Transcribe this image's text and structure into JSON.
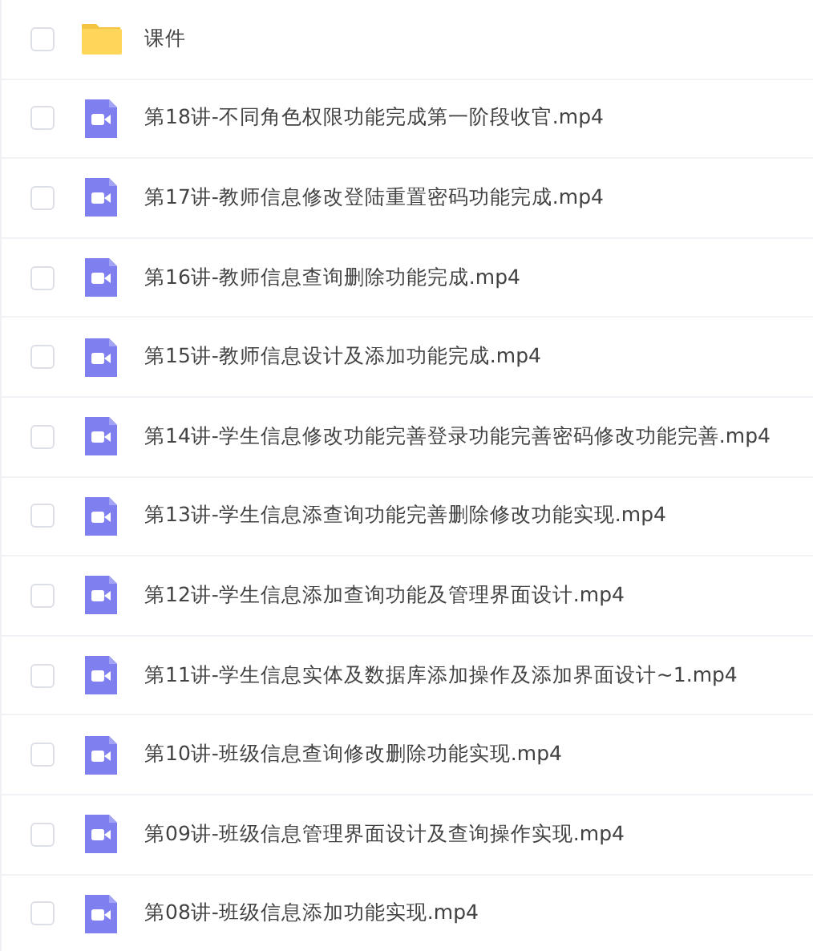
{
  "files": [
    {
      "kind": "folder",
      "name": "课件",
      "checked": false
    },
    {
      "kind": "video",
      "name": "第18讲-不同角色权限功能完成第一阶段收官.mp4",
      "checked": false
    },
    {
      "kind": "video",
      "name": "第17讲-教师信息修改登陆重置密码功能完成.mp4",
      "checked": false
    },
    {
      "kind": "video",
      "name": "第16讲-教师信息查询删除功能完成.mp4",
      "checked": false
    },
    {
      "kind": "video",
      "name": "第15讲-教师信息设计及添加功能完成.mp4",
      "checked": false
    },
    {
      "kind": "video",
      "name": "第14讲-学生信息修改功能完善登录功能完善密码修改功能完善.mp4",
      "checked": false
    },
    {
      "kind": "video",
      "name": "第13讲-学生信息添查询功能完善删除修改功能实现.mp4",
      "checked": false
    },
    {
      "kind": "video",
      "name": "第12讲-学生信息添加查询功能及管理界面设计.mp4",
      "checked": false
    },
    {
      "kind": "video",
      "name": "第11讲-学生信息实体及数据库添加操作及添加界面设计~1.mp4",
      "checked": false
    },
    {
      "kind": "video",
      "name": "第10讲-班级信息查询修改删除功能实现.mp4",
      "checked": false
    },
    {
      "kind": "video",
      "name": "第09讲-班级信息管理界面设计及查询操作实现.mp4",
      "checked": false
    },
    {
      "kind": "video",
      "name": "第08讲-班级信息添加功能实现.mp4",
      "checked": false
    }
  ]
}
